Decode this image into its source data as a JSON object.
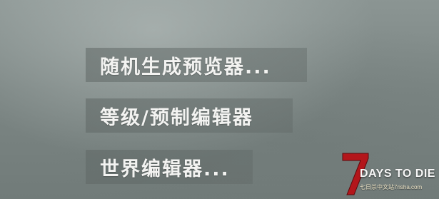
{
  "menu": {
    "items": [
      {
        "label": "随机生成预览器..."
      },
      {
        "label": "等级/预制编辑器"
      },
      {
        "label": "世界编辑器..."
      }
    ]
  },
  "watermark": {
    "logo_number": "7",
    "title": "DAYS TO DIE",
    "subtitle": "七日杀中文站7risha.com",
    "accent_color": "#b3161b"
  }
}
